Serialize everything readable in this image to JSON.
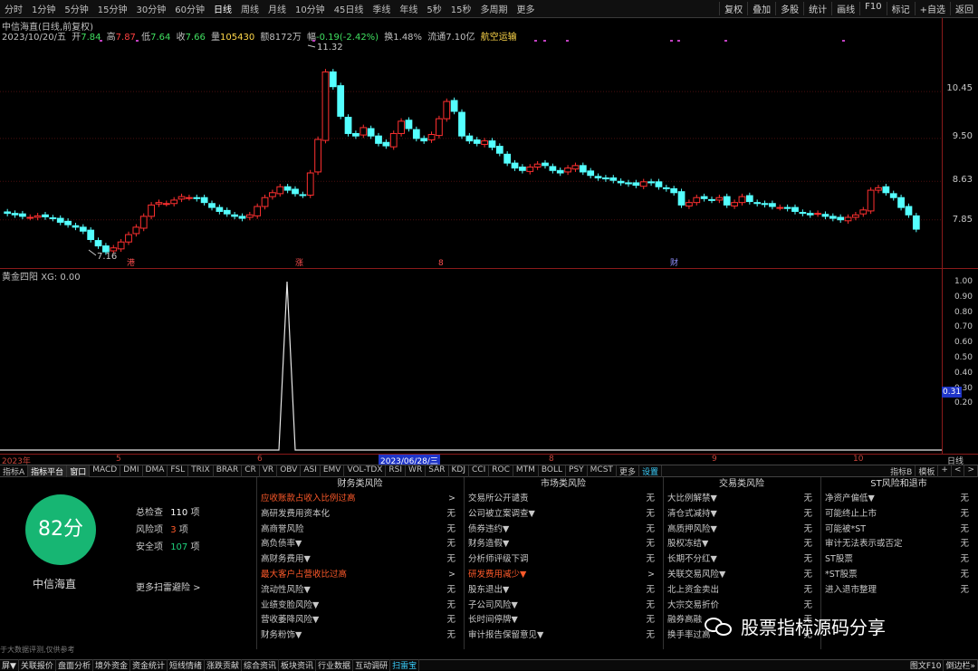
{
  "toolbar": {
    "periods": [
      "分时",
      "1分钟",
      "5分钟",
      "15分钟",
      "30分钟",
      "60分钟",
      "日线",
      "周线",
      "月线",
      "10分钟",
      "45日线",
      "季线",
      "年线",
      "5秒",
      "15秒",
      "多周期",
      "更多"
    ],
    "active_period": "日线",
    "right": [
      "复权",
      "叠加",
      "多股",
      "统计",
      "画线",
      "F10",
      "标记",
      "+自选",
      "返回"
    ]
  },
  "chart": {
    "title": "中信海直(日线,前复权)",
    "date": "2023/10/20/五",
    "open_label": "开",
    "open": "7.84",
    "high_label": "高",
    "high": "7.87",
    "low_label": "低",
    "low": "7.64",
    "close_label": "收",
    "close": "7.66",
    "vol_label": "量",
    "volume": "105430",
    "amt_label": "额",
    "amount": "8172万",
    "chg_label": "幅",
    "change": "-0.19(-2.42%)",
    "turnover_label": "换",
    "turnover": "1.48%",
    "float_label": "流通",
    "float_cap": "7.10亿",
    "sector": "航空运输",
    "price_labels": [
      "10.45",
      "9.50",
      "8.63",
      "7.85"
    ],
    "high_mark": "11.32",
    "low_mark": "7.16",
    "event_marks": [
      "港",
      "涨",
      "8",
      "财"
    ]
  },
  "chart_data": {
    "type": "candlestick",
    "title": "中信海直(日线,前复权)",
    "series_close": [
      7.98,
      7.95,
      7.92,
      7.9,
      7.93,
      7.91,
      7.88,
      7.8,
      7.75,
      7.7,
      7.62,
      7.45,
      7.32,
      7.2,
      7.28,
      7.4,
      7.55,
      7.7,
      7.92,
      8.15,
      8.2,
      8.18,
      8.25,
      8.32,
      8.3,
      8.28,
      8.2,
      8.1,
      8.02,
      7.97,
      7.92,
      7.88,
      7.95,
      8.12,
      8.3,
      8.4,
      8.52,
      8.45,
      8.38,
      8.35,
      8.8,
      9.48,
      10.85,
      10.55,
      9.95,
      9.6,
      9.55,
      9.72,
      9.55,
      9.4,
      9.35,
      9.6,
      9.85,
      9.7,
      9.5,
      9.45,
      9.58,
      9.9,
      10.25,
      10.05,
      9.55,
      9.45,
      9.4,
      9.45,
      9.32,
      9.2,
      9.0,
      8.9,
      8.85,
      8.92,
      8.98,
      8.95,
      8.85,
      8.8,
      8.9,
      8.95,
      8.82,
      8.75,
      8.7,
      8.68,
      8.65,
      8.6,
      8.58,
      8.55,
      8.62,
      8.6,
      8.52,
      8.48,
      8.4,
      8.15,
      8.2,
      8.3,
      8.28,
      8.25,
      8.3,
      8.15,
      8.2,
      8.32,
      8.22,
      8.18,
      8.16,
      8.12,
      8.1,
      8.08,
      8.02,
      7.98,
      7.95,
      7.98,
      7.92,
      7.88,
      7.85,
      7.9,
      7.95,
      8.05,
      8.45,
      8.5,
      8.4,
      8.3,
      8.1,
      7.95,
      7.66
    ],
    "ylim": [
      7.0,
      11.5
    ],
    "x_ticks": [
      "2023年",
      "5",
      "6",
      "2023/06/28/三",
      "8",
      "9",
      "10"
    ]
  },
  "indicator": {
    "name": "黄金四阳",
    "value_label": "XG:",
    "value": "0.00",
    "axis_labels": [
      "1.00",
      "0.90",
      "0.80",
      "0.70",
      "0.60",
      "0.50",
      "0.40",
      "0.30",
      "0.20"
    ],
    "current": "0.31",
    "period": "日线"
  },
  "indicator_tabs": {
    "items": [
      "指标A",
      "指标平台",
      "窗口",
      "MACD",
      "DMI",
      "DMA",
      "FSL",
      "TRIX",
      "BRAR",
      "CR",
      "VR",
      "OBV",
      "ASI",
      "EMV",
      "VOL-TDX",
      "RSI",
      "WR",
      "SAR",
      "KDJ",
      "CCI",
      "ROC",
      "MTM",
      "BOLL",
      "PSY",
      "MCST",
      "更多",
      "设置"
    ],
    "right": [
      "指标B",
      "模板",
      "+",
      "<",
      ">"
    ]
  },
  "risk": {
    "score": "82分",
    "company": "中信海直",
    "total_label": "总检查",
    "total": "110",
    "total_unit": "项",
    "risk_label": "风险项",
    "risk": "3",
    "risk_unit": "项",
    "safe_label": "安全项",
    "safe": "107",
    "safe_unit": "项",
    "more": "更多扫雷避险 >",
    "disclaimer": "于大数据评测,仅供参考",
    "columns": [
      {
        "title": "财务类风险",
        "rows": [
          {
            "label": "应收账款占收入比例过高",
            "status": ">",
            "hi": true
          },
          {
            "label": "高研发费用资本化",
            "status": "无"
          },
          {
            "label": "高商誉风险",
            "status": "无"
          },
          {
            "label": "高负债率▼",
            "status": "无"
          },
          {
            "label": "高财务费用▼",
            "status": "无"
          },
          {
            "label": "最大客户占营收比过高",
            "status": ">",
            "hi": true
          },
          {
            "label": "流动性风险▼",
            "status": "无"
          },
          {
            "label": "业绩变脸风险▼",
            "status": "无"
          },
          {
            "label": "营收萎降风险▼",
            "status": "无"
          },
          {
            "label": "财务粉饰▼",
            "status": "无"
          }
        ]
      },
      {
        "title": "市场类风险",
        "rows": [
          {
            "label": "交易所公开谴责",
            "status": "无"
          },
          {
            "label": "公司被立案调查▼",
            "status": "无"
          },
          {
            "label": "债券违约▼",
            "status": "无"
          },
          {
            "label": "财务造假▼",
            "status": "无"
          },
          {
            "label": "分析师评级下调",
            "status": "无"
          },
          {
            "label": "研发费用减少▼",
            "status": ">",
            "hi": true
          },
          {
            "label": "股东退出▼",
            "status": "无"
          },
          {
            "label": "子公司风险▼",
            "status": "无"
          },
          {
            "label": "长时间停牌▼",
            "status": "无"
          },
          {
            "label": "审计报告保留意见▼",
            "status": "无"
          }
        ]
      },
      {
        "title": "交易类风险",
        "rows": [
          {
            "label": "大比例解禁▼",
            "status": "无"
          },
          {
            "label": "清仓式减持▼",
            "status": "无"
          },
          {
            "label": "高质押风险▼",
            "status": "无"
          },
          {
            "label": "股权冻结▼",
            "status": "无"
          },
          {
            "label": "长期不分红▼",
            "status": "无"
          },
          {
            "label": "关联交易风险▼",
            "status": "无"
          },
          {
            "label": "北上资金卖出",
            "status": "无"
          },
          {
            "label": "大宗交易折价",
            "status": "无"
          },
          {
            "label": "融券高融",
            "status": "无"
          },
          {
            "label": "换手率过高",
            "status": "无"
          }
        ]
      },
      {
        "title": "ST风险和退市",
        "rows": [
          {
            "label": "净资产偏低▼",
            "status": "无"
          },
          {
            "label": "可能终止上市",
            "status": "无"
          },
          {
            "label": "可能被*ST",
            "status": "无"
          },
          {
            "label": "审计无法表示或否定",
            "status": "无"
          },
          {
            "label": "ST股票",
            "status": "无"
          },
          {
            "label": "*ST股票",
            "status": "无"
          },
          {
            "label": "进入退市整理",
            "status": "无"
          }
        ]
      }
    ]
  },
  "watermark": "股票指标源码分享",
  "bottom_tabs": {
    "items": [
      "屏▼",
      "关联报价",
      "盘面分析",
      "境外资金",
      "资金统计",
      "短线情绪",
      "涨跌贡献",
      "综合资讯",
      "板块资讯",
      "行业数据",
      "互动调研",
      "扫雷宝"
    ],
    "selected": "扫雷宝",
    "right": [
      "图文F10",
      "倒边栏»"
    ]
  }
}
